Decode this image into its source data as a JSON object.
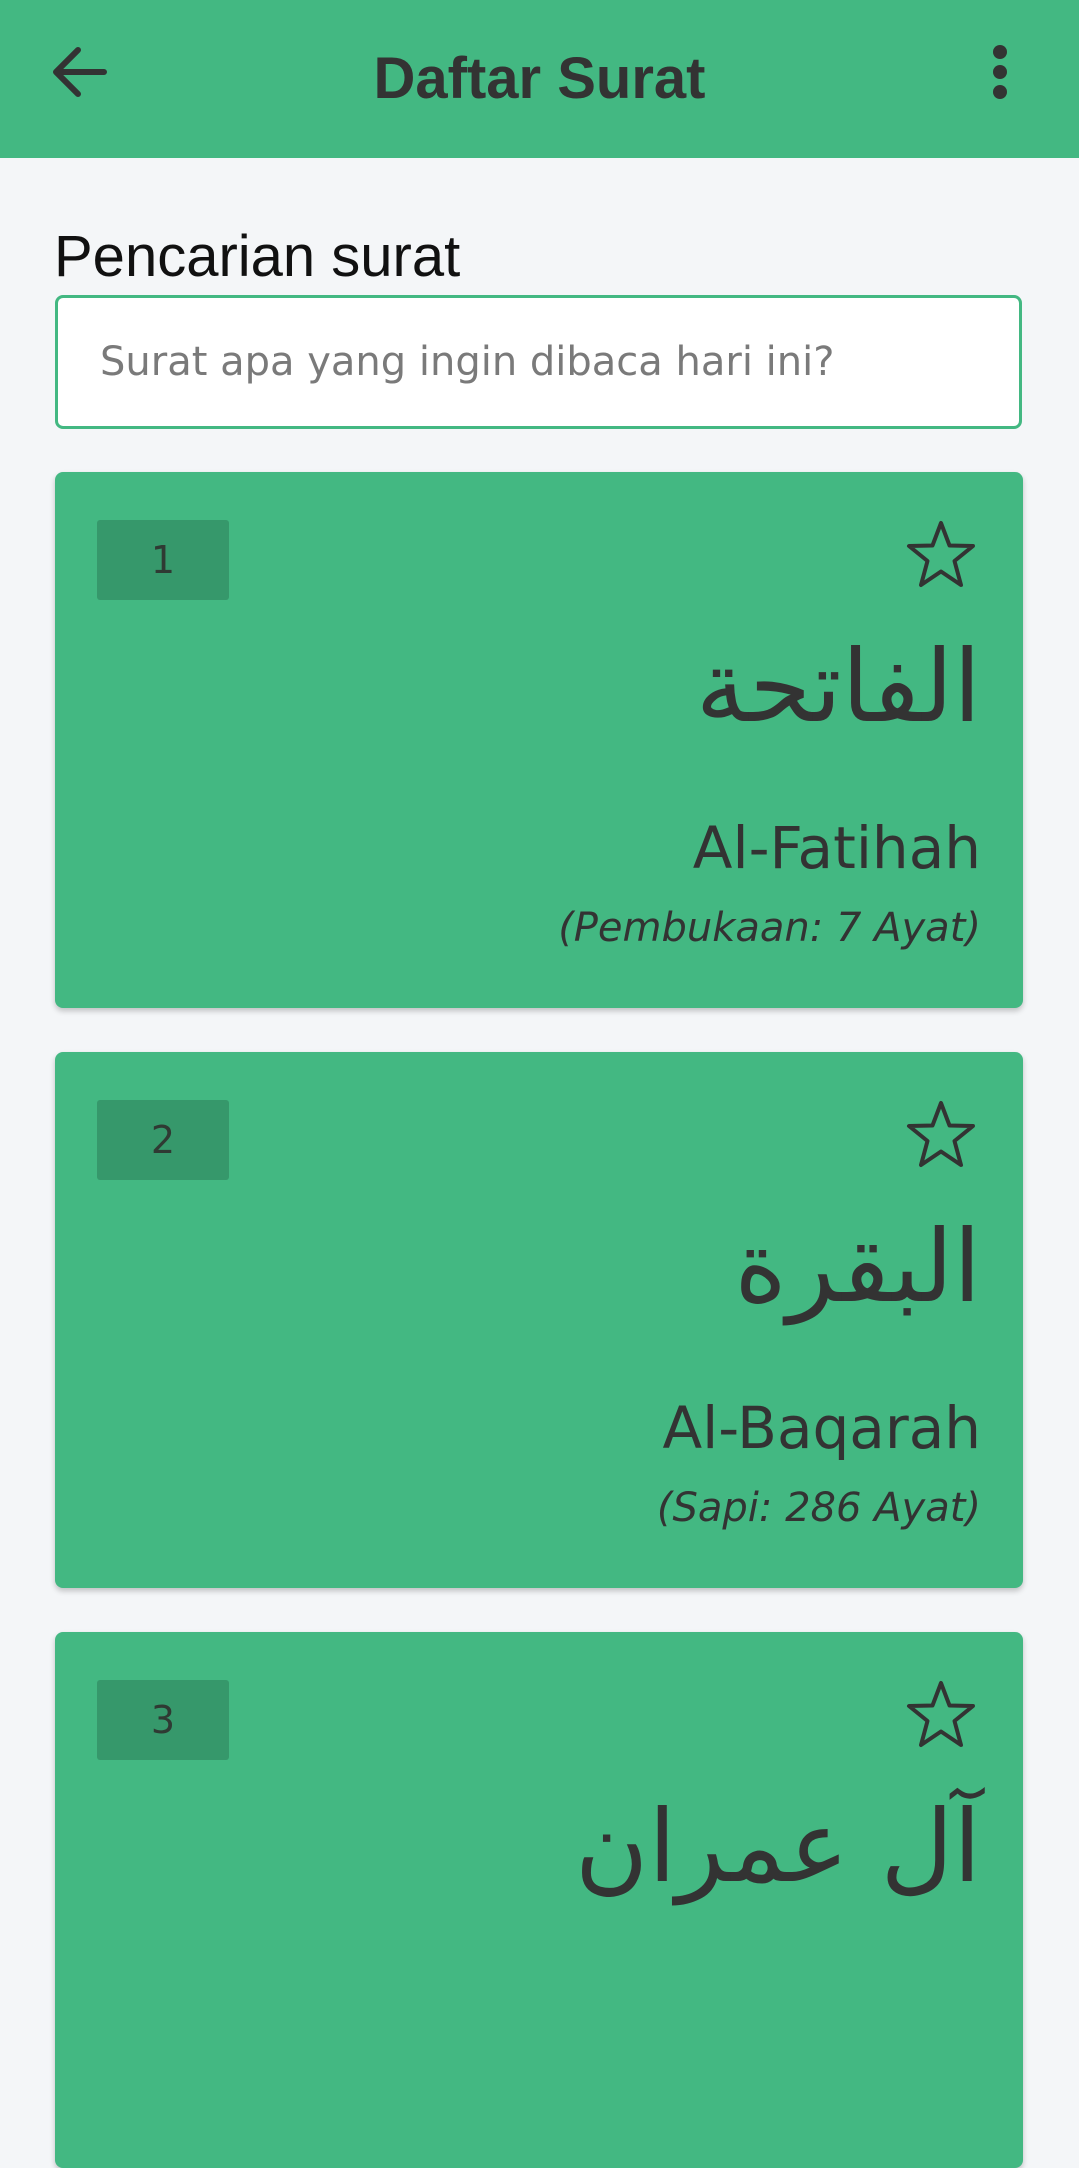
{
  "appbar": {
    "title": "Daftar Surat",
    "background": "#43b882",
    "back_icon": "arrow-left-icon",
    "menu_icon": "more-vertical-icon"
  },
  "search": {
    "label": "Pencarian surat",
    "placeholder": "Surat apa yang ingin dibaca hari ini?",
    "value": "",
    "border_color": "#43b882"
  },
  "surah_list": [
    {
      "number": "1",
      "arabic": "الفاتحة",
      "name": "Al-Fatihah",
      "meaning": "Pembukaan",
      "ayat": "7 Ayat",
      "favorite_icon": "star-outline-icon"
    },
    {
      "number": "2",
      "arabic": "البقرة",
      "name": "Al-Baqarah",
      "meaning": "Sapi",
      "ayat": "286 Ayat",
      "favorite_icon": "star-outline-icon"
    },
    {
      "number": "3",
      "arabic": "آل عمران",
      "favorite_icon": "star-outline-icon"
    }
  ],
  "colors": {
    "card": "#43b882",
    "badge": "#36986b",
    "page_background": "#f4f6f8",
    "text": "#333333"
  }
}
